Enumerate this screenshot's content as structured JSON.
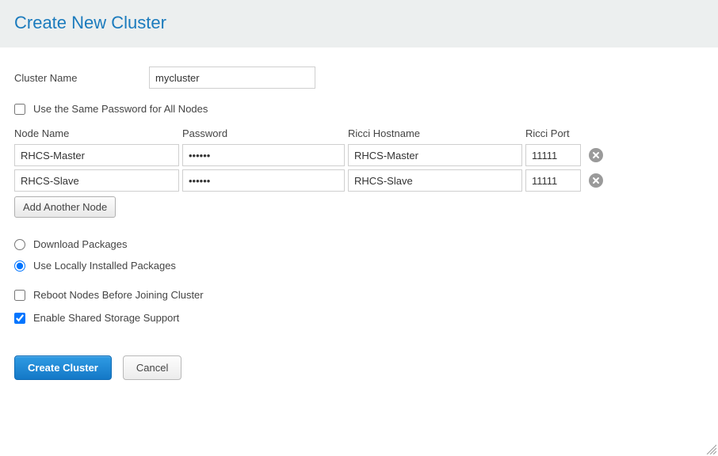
{
  "header": {
    "title": "Create New Cluster"
  },
  "form": {
    "cluster_name_label": "Cluster Name",
    "cluster_name_value": "mycluster",
    "same_password_label": "Use the Same Password for All Nodes",
    "same_password_checked": false,
    "nodes_headers": {
      "node_name": "Node Name",
      "password": "Password",
      "ricci_hostname": "Ricci Hostname",
      "ricci_port": "Ricci Port"
    },
    "nodes": [
      {
        "name": "RHCS-Master",
        "password": "••••••",
        "hostname": "RHCS-Master",
        "port": "11111"
      },
      {
        "name": "RHCS-Slave",
        "password": "••••••",
        "hostname": "RHCS-Slave",
        "port": "11111"
      }
    ],
    "add_node_label": "Add Another Node",
    "package_source": {
      "download_label": "Download Packages",
      "local_label": "Use Locally Installed Packages",
      "selected": "local"
    },
    "reboot_label": "Reboot Nodes Before Joining Cluster",
    "reboot_checked": false,
    "shared_storage_label": "Enable Shared Storage Support",
    "shared_storage_checked": true
  },
  "actions": {
    "create_label": "Create Cluster",
    "cancel_label": "Cancel"
  }
}
